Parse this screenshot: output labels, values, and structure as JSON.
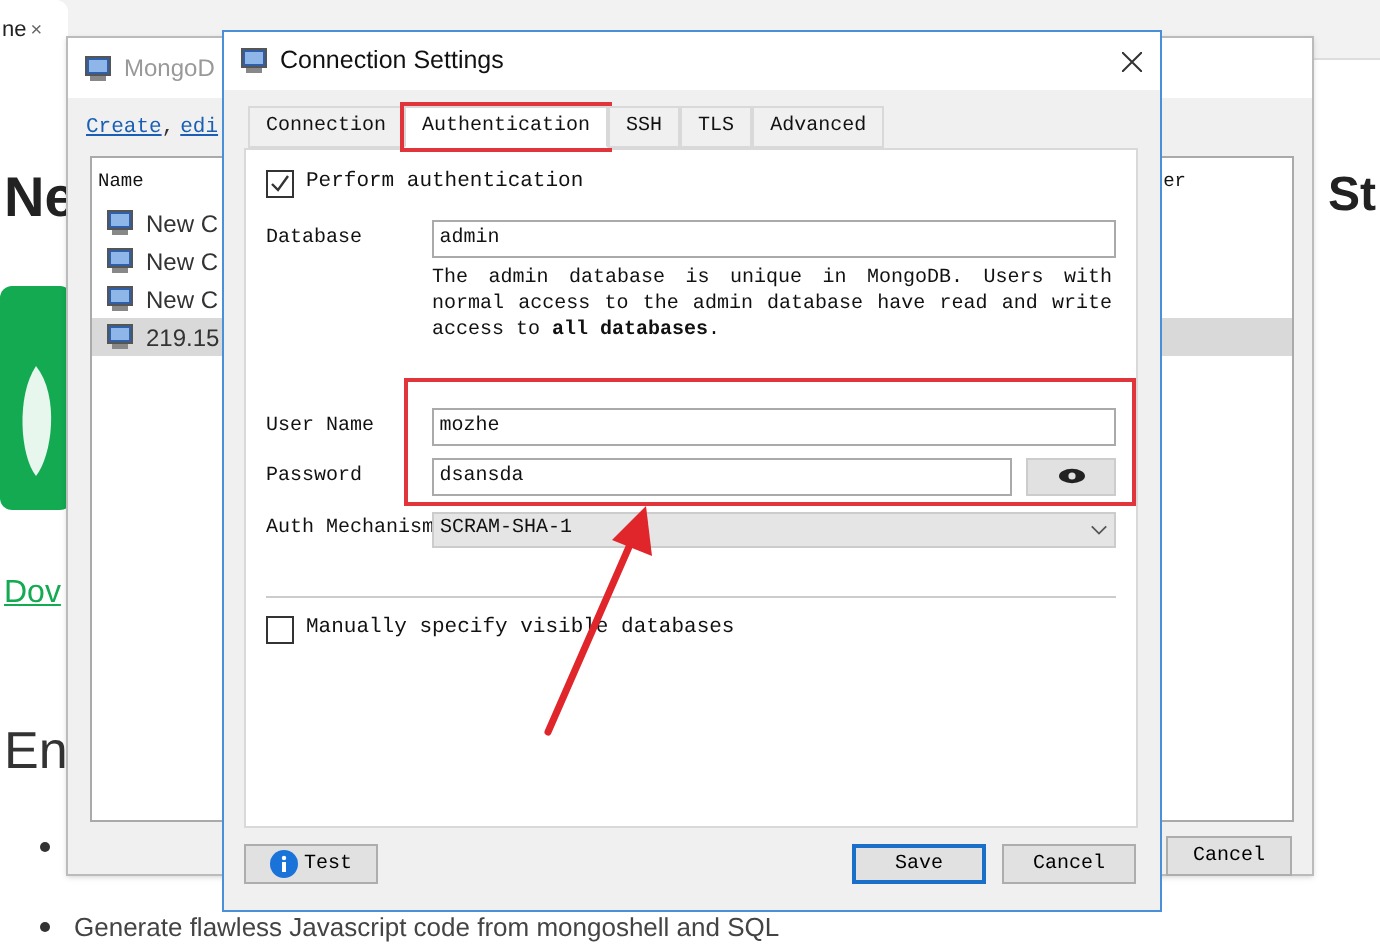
{
  "browser": {
    "tab_title": "ne",
    "tab_close": "×"
  },
  "page": {
    "heading_left": "Ne",
    "heading_right": "St",
    "link": "Dov",
    "section_heading": "En",
    "bullets": [
      {
        "kind": "hidden"
      },
      {
        "kind": "text",
        "text": "Generate flawless Javascript code from mongoshell and SQL"
      }
    ]
  },
  "back_window": {
    "title": "MongoD",
    "toolbar": [
      {
        "kind": "link",
        "text": "Create"
      },
      {
        "kind": "text",
        "text": ","
      },
      {
        "kind": "link",
        "text": "edi"
      }
    ],
    "columns": [
      "Name",
      "er"
    ],
    "rows": [
      {
        "name": "New C",
        "selected": false
      },
      {
        "name": "New C",
        "selected": false
      },
      {
        "name": "New C",
        "selected": false
      },
      {
        "name": "219.15",
        "selected": true
      }
    ],
    "cancel": "Cancel"
  },
  "dialog": {
    "title": "Connection Settings",
    "tabs": [
      {
        "label": "Connection",
        "selected": false,
        "highlighted": false
      },
      {
        "label": "Authentication",
        "selected": true,
        "highlighted": true
      },
      {
        "label": "SSH",
        "selected": false,
        "highlighted": false
      },
      {
        "label": "TLS",
        "selected": false,
        "highlighted": false
      },
      {
        "label": "Advanced",
        "selected": false,
        "highlighted": false
      }
    ],
    "perform_auth": {
      "label": "Perform authentication",
      "checked": true
    },
    "database": {
      "label": "Database",
      "value": "admin"
    },
    "help": "The admin database is unique in MongoDB. Users with normal access to the admin database have read and write access to **all databases**.",
    "user_name": {
      "label": "User Name",
      "value": "mozhe"
    },
    "password": {
      "label": "Password",
      "value": "dsansda"
    },
    "auth_mechanism": {
      "label": "Auth Mechanism",
      "value": "SCRAM-SHA-1"
    },
    "manual_dbs": {
      "label": "Manually specify visible databases",
      "checked": false
    },
    "buttons": [
      {
        "kind": "test",
        "label": "Test"
      },
      {
        "kind": "save",
        "label": "Save"
      },
      {
        "kind": "cancel",
        "label": "Cancel"
      }
    ]
  }
}
